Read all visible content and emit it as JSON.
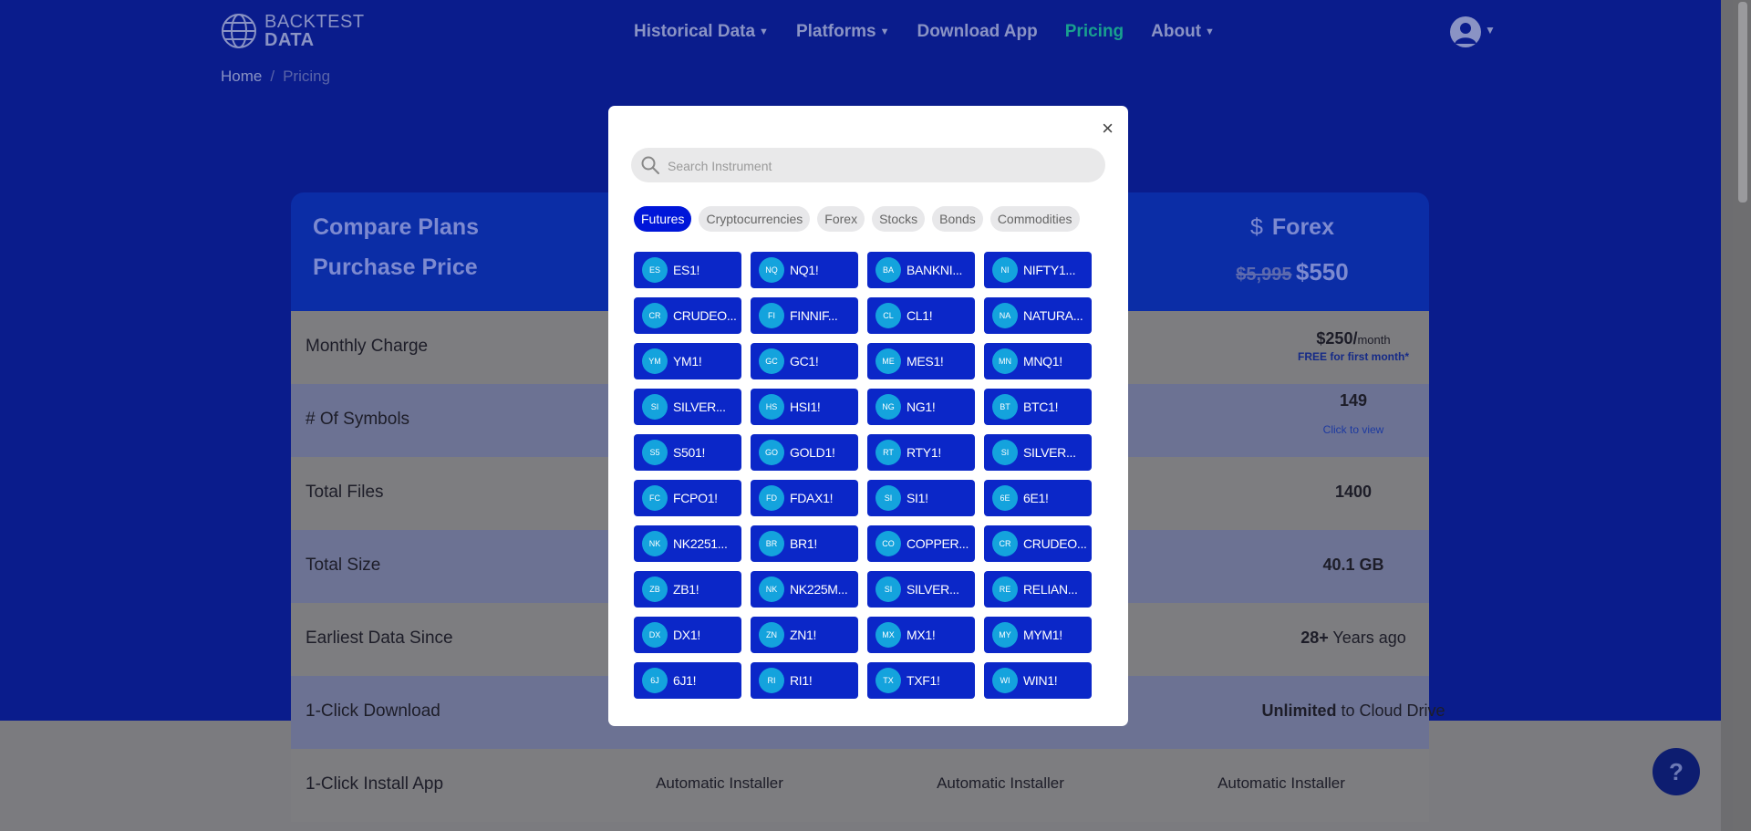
{
  "brand": {
    "line1": "BACKTEST",
    "line2": "DATA"
  },
  "nav": {
    "items": [
      {
        "label": "Historical Data",
        "caret": true,
        "active": false
      },
      {
        "label": "Platforms",
        "caret": true,
        "active": false
      },
      {
        "label": "Download App",
        "caret": false,
        "active": false
      },
      {
        "label": "Pricing",
        "caret": false,
        "active": true
      },
      {
        "label": "About",
        "caret": true,
        "active": false
      }
    ]
  },
  "breadcrumb": {
    "home": "Home",
    "separator": "/",
    "current": "Pricing"
  },
  "pricing": {
    "compare_title": "Compare Plans",
    "purchase_label": "Purchase Price",
    "forex_icon": "$",
    "forex_title": "Forex",
    "forex_old_price": "$5,995",
    "forex_price": "$550",
    "rows": [
      {
        "label": "Monthly Charge",
        "value": "$250/",
        "suffix": "month",
        "note": "FREE for first month*"
      },
      {
        "label": "# Of Symbols",
        "value": "149",
        "link": "Click to view"
      },
      {
        "label": "Total Files",
        "value": "1400"
      },
      {
        "label": "Total Size",
        "value": "40.1 GB"
      },
      {
        "label": "Earliest Data Since",
        "value": "28+",
        "suffix": " Years ago"
      },
      {
        "label": "1-Click Download",
        "value": "Unlimited",
        "suffix": " to Cloud Drive"
      },
      {
        "label": "1-Click Install App",
        "installer": [
          "Automatic Installer",
          "Automatic Installer",
          "Automatic Installer"
        ]
      }
    ]
  },
  "modal": {
    "close_symbol": "×",
    "search_placeholder": "Search Instrument",
    "tabs": [
      {
        "label": "Futures",
        "active": true
      },
      {
        "label": "Cryptocurrencies",
        "active": false
      },
      {
        "label": "Forex",
        "active": false
      },
      {
        "label": "Stocks",
        "active": false
      },
      {
        "label": "Bonds",
        "active": false
      },
      {
        "label": "Commodities",
        "active": false
      }
    ],
    "instruments": [
      {
        "abbr": "ES",
        "name": "ES1!"
      },
      {
        "abbr": "NQ",
        "name": "NQ1!"
      },
      {
        "abbr": "BA",
        "name": "BANKNI..."
      },
      {
        "abbr": "NI",
        "name": "NIFTY1..."
      },
      {
        "abbr": "CR",
        "name": "CRUDEO..."
      },
      {
        "abbr": "FI",
        "name": "FINNIF..."
      },
      {
        "abbr": "CL",
        "name": "CL1!"
      },
      {
        "abbr": "NA",
        "name": "NATURA..."
      },
      {
        "abbr": "YM",
        "name": "YM1!"
      },
      {
        "abbr": "GC",
        "name": "GC1!"
      },
      {
        "abbr": "ME",
        "name": "MES1!"
      },
      {
        "abbr": "MN",
        "name": "MNQ1!"
      },
      {
        "abbr": "SI",
        "name": "SILVER..."
      },
      {
        "abbr": "HS",
        "name": "HSI1!"
      },
      {
        "abbr": "NG",
        "name": "NG1!"
      },
      {
        "abbr": "BT",
        "name": "BTC1!"
      },
      {
        "abbr": "S5",
        "name": "S501!"
      },
      {
        "abbr": "GO",
        "name": "GOLD1!"
      },
      {
        "abbr": "RT",
        "name": "RTY1!"
      },
      {
        "abbr": "SI",
        "name": "SILVER..."
      },
      {
        "abbr": "FC",
        "name": "FCPO1!"
      },
      {
        "abbr": "FD",
        "name": "FDAX1!"
      },
      {
        "abbr": "SI",
        "name": "SI1!"
      },
      {
        "abbr": "6E",
        "name": "6E1!"
      },
      {
        "abbr": "NK",
        "name": "NK2251..."
      },
      {
        "abbr": "BR",
        "name": "BR1!"
      },
      {
        "abbr": "CO",
        "name": "COPPER..."
      },
      {
        "abbr": "CR",
        "name": "CRUDEO..."
      },
      {
        "abbr": "ZB",
        "name": "ZB1!"
      },
      {
        "abbr": "NK",
        "name": "NK225M..."
      },
      {
        "abbr": "SI",
        "name": "SILVER..."
      },
      {
        "abbr": "RE",
        "name": "RELIAN..."
      },
      {
        "abbr": "DX",
        "name": "DX1!"
      },
      {
        "abbr": "ZN",
        "name": "ZN1!"
      },
      {
        "abbr": "MX",
        "name": "MX1!"
      },
      {
        "abbr": "MY",
        "name": "MYM1!"
      },
      {
        "abbr": "6J",
        "name": "6J1!"
      },
      {
        "abbr": "RI",
        "name": "RI1!"
      },
      {
        "abbr": "TX",
        "name": "TXF1!"
      },
      {
        "abbr": "WI",
        "name": "WIN1!"
      }
    ]
  },
  "help": {
    "symbol": "?"
  },
  "colors": {
    "accent": "#0016d9",
    "instrument_bg": "#0b27c8",
    "badge": "#14a3dd",
    "active_nav": "#19a08e"
  }
}
